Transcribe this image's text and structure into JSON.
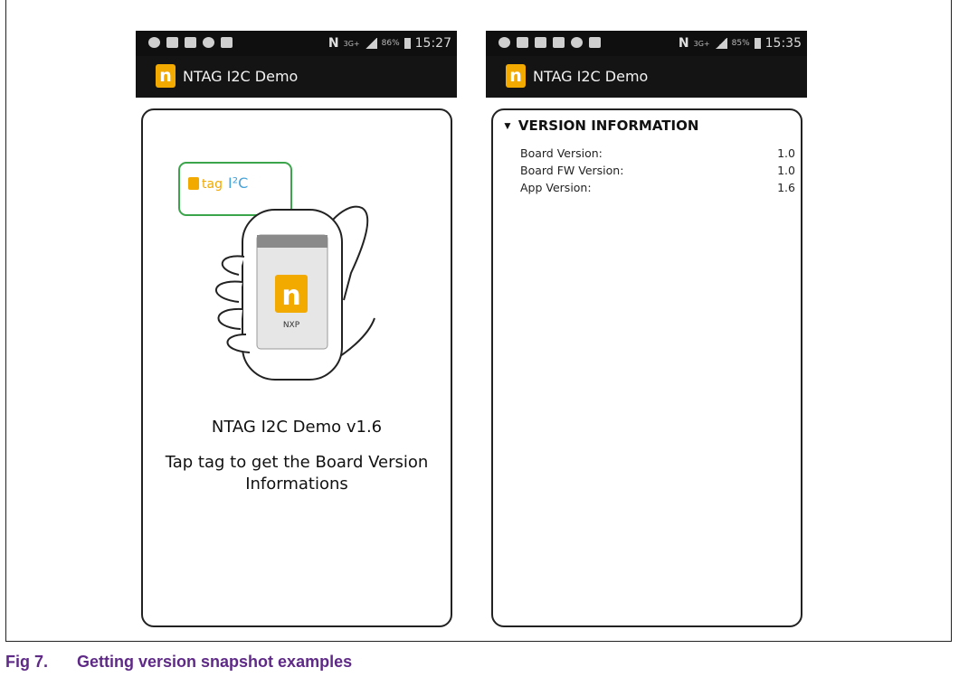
{
  "left_screen": {
    "status": {
      "network": "3G+",
      "battery": "86%",
      "time": "15:27"
    },
    "app_title": "NTAG I2C Demo",
    "illustration": {
      "tag_label_prefix": "tag",
      "tag_label_suffix": "I²C",
      "phone_logo_caption": "NXP"
    },
    "demo_version": "NTAG I2C Demo v1.6",
    "instruction": "Tap tag to get the Board Version Informations"
  },
  "right_screen": {
    "status": {
      "network": "3G+",
      "battery": "85%",
      "time": "15:35"
    },
    "app_title": "NTAG I2C Demo",
    "section_title": "VERSION INFORMATION",
    "rows": [
      {
        "label": "Board Version:",
        "value": "1.0"
      },
      {
        "label": "Board FW Version:",
        "value": "1.0"
      },
      {
        "label": "App Version:",
        "value": "1.6"
      }
    ]
  },
  "caption": {
    "number": "Fig 7.",
    "title": "Getting version snapshot examples"
  },
  "colors": {
    "caption": "#5f2a87",
    "app_bar": "#141414",
    "logo": "#f2a900",
    "tag_border": "#3aa54a"
  },
  "icons": [
    "wifi-icon",
    "notification-icon",
    "nfc-icon",
    "signal-icon",
    "battery-icon",
    "app-logo-icon",
    "triangle-down-icon"
  ]
}
